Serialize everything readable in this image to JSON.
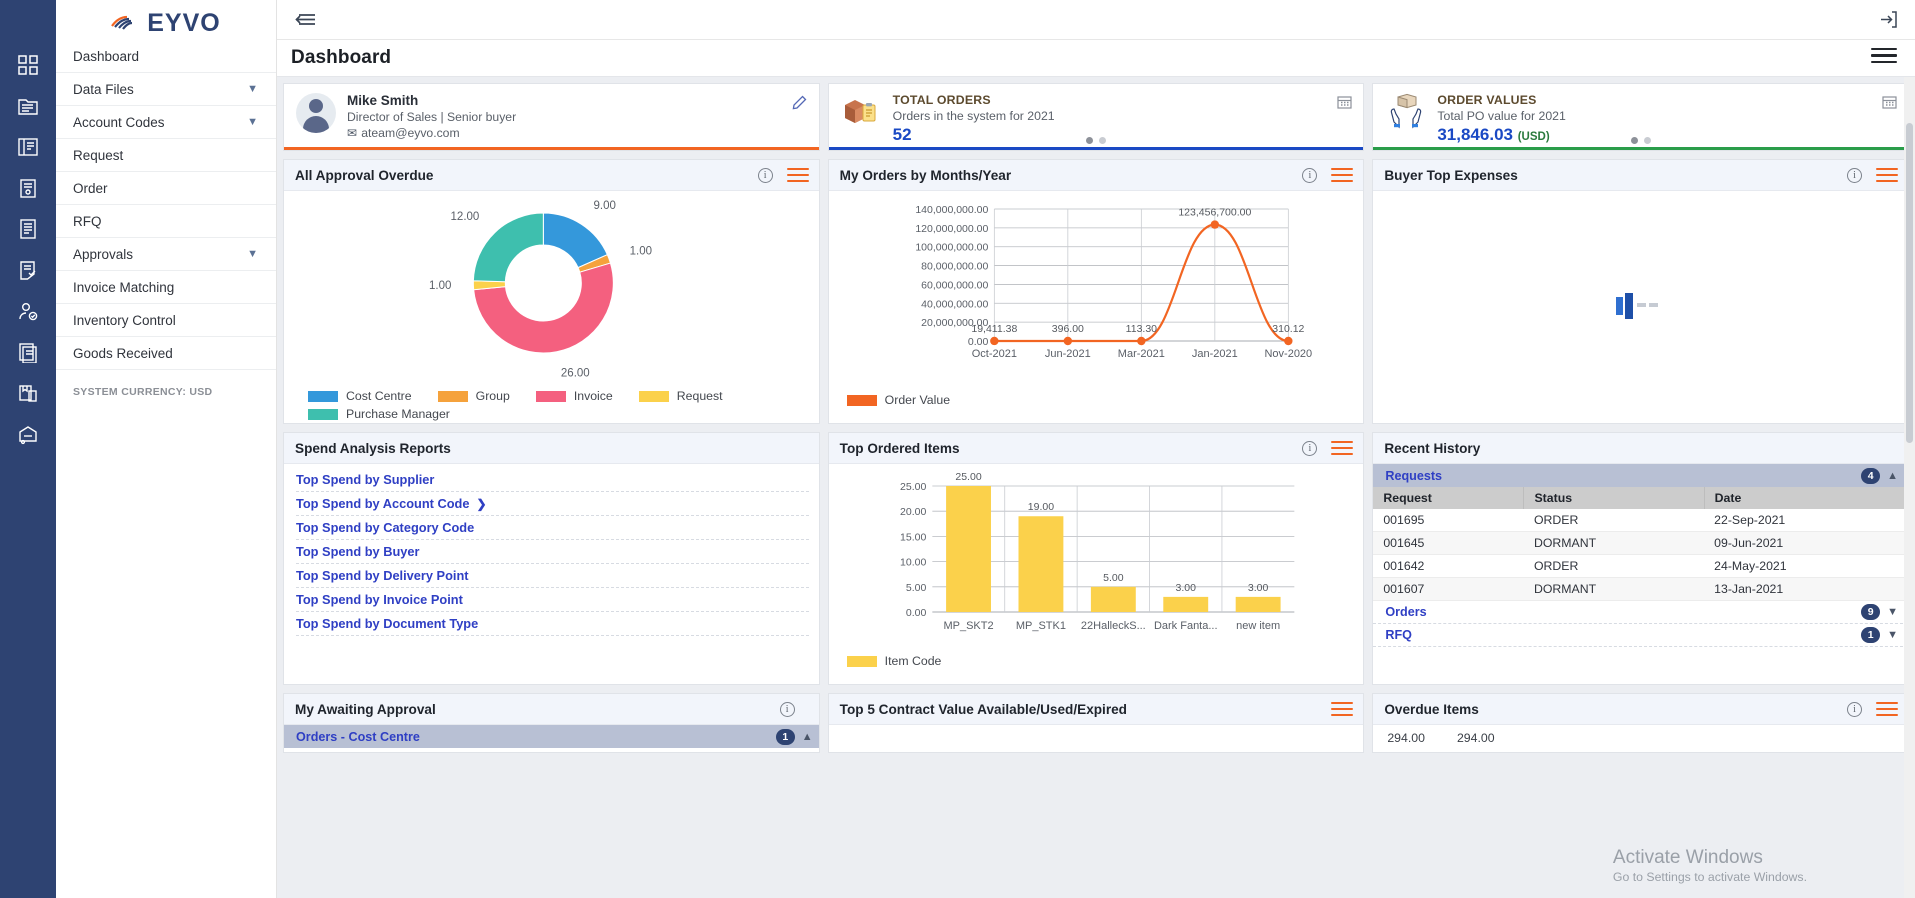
{
  "brand": {
    "name": "EYVO"
  },
  "sidebar": {
    "items": [
      {
        "label": "Dashboard",
        "icon": "grid-icon",
        "expandable": false
      },
      {
        "label": "Data Files",
        "icon": "folder-icon",
        "expandable": true
      },
      {
        "label": "Account Codes",
        "icon": "ledger-icon",
        "expandable": true
      },
      {
        "label": "Request",
        "icon": "request-icon",
        "expandable": false
      },
      {
        "label": "Order",
        "icon": "order-icon",
        "expandable": false
      },
      {
        "label": "RFQ",
        "icon": "rfq-icon",
        "expandable": false
      },
      {
        "label": "Approvals",
        "icon": "approval-user-icon",
        "expandable": true
      },
      {
        "label": "Invoice Matching",
        "icon": "invoice-icon",
        "expandable": false
      },
      {
        "label": "Inventory Control",
        "icon": "inventory-icon",
        "expandable": false
      },
      {
        "label": "Goods Received",
        "icon": "goods-icon",
        "expandable": false
      }
    ],
    "footer": "SYSTEM CURRENCY: USD"
  },
  "header": {
    "title": "Dashboard"
  },
  "profile": {
    "name": "Mike Smith",
    "role": "Director of Sales | Senior buyer",
    "email": "ateam@eyvo.com",
    "accent": "#f26522"
  },
  "total_orders": {
    "title": "TOTAL ORDERS",
    "subtitle": "Orders in the system for 2021",
    "value": "52",
    "accent": "#1a49c4"
  },
  "order_values": {
    "title": "ORDER VALUES",
    "subtitle": "Total PO value for 2021",
    "value": "31,846.03",
    "currency": "(USD)",
    "accent": "#2a9d4a"
  },
  "widgets": {
    "approval_overdue": {
      "title": "All Approval Overdue"
    },
    "orders_by_month": {
      "title": "My Orders by Months/Year"
    },
    "buyer_top_expenses": {
      "title": "Buyer Top Expenses"
    },
    "spend_analysis": {
      "title": "Spend Analysis Reports"
    },
    "top_ordered_items": {
      "title": "Top Ordered Items"
    },
    "recent_history": {
      "title": "Recent History"
    },
    "my_awaiting_approval": {
      "title": "My Awaiting Approval"
    },
    "top5_contract": {
      "title": "Top 5 Contract Value Available/Used/Expired"
    },
    "overdue_items": {
      "title": "Overdue Items"
    }
  },
  "spend_reports": [
    {
      "label": "Top Spend by Supplier",
      "arrow": false
    },
    {
      "label": "Top Spend by Account Code",
      "arrow": true
    },
    {
      "label": "Top Spend by Category Code",
      "arrow": false
    },
    {
      "label": "Top Spend by Buyer",
      "arrow": false
    },
    {
      "label": "Top Spend by Delivery Point",
      "arrow": false
    },
    {
      "label": "Top Spend by Invoice Point",
      "arrow": false
    },
    {
      "label": "Top Spend by Document Type",
      "arrow": false
    }
  ],
  "recent_history": {
    "groups": [
      {
        "label": "Requests",
        "count": "4",
        "caret": "up",
        "active": true
      },
      {
        "label": "Orders",
        "count": "9",
        "caret": "down",
        "active": false
      },
      {
        "label": "RFQ",
        "count": "1",
        "caret": "down",
        "active": false
      }
    ],
    "columns": [
      "Request",
      "Status",
      "Date"
    ],
    "rows": [
      [
        "001695",
        "ORDER",
        "22-Sep-2021"
      ],
      [
        "001645",
        "DORMANT",
        "09-Jun-2021"
      ],
      [
        "001642",
        "ORDER",
        "24-May-2021"
      ],
      [
        "001607",
        "DORMANT",
        "13-Jan-2021"
      ]
    ]
  },
  "awaiting_approval": {
    "rows": [
      {
        "label": "Orders - Cost Centre",
        "count": "1",
        "caret": "up"
      }
    ]
  },
  "overdue_items": {
    "values": [
      "294.00",
      "294.00"
    ]
  },
  "watermark": {
    "line1": "Activate Windows",
    "line2": "Go to Settings to activate Windows."
  },
  "chart_data": [
    {
      "id": "approval-overdue-donut",
      "type": "pie",
      "title": "All Approval Overdue",
      "categories": [
        "Cost Centre",
        "Group",
        "Invoice",
        "Request",
        "Purchase Manager"
      ],
      "values": [
        9.0,
        1.0,
        26.0,
        1.0,
        12.0
      ],
      "labels": [
        "9.00",
        "1.00",
        "26.00",
        "1.00",
        "12.00"
      ],
      "colors": [
        "#3498db",
        "#f5a23c",
        "#f4607f",
        "#f9d košt"
      ],
      "palette": [
        "#3498db",
        "#f5a23c",
        "#f4607f",
        "#fbd14b",
        "#3ebfae"
      ],
      "legend_position": "bottom",
      "donut": true
    },
    {
      "id": "orders-by-month-line",
      "type": "line",
      "title": "My Orders by Months/Year",
      "x": [
        "Oct-2021",
        "Jun-2021",
        "Mar-2021",
        "Jan-2021",
        "Nov-2020"
      ],
      "series": [
        {
          "name": "Order Value",
          "values": [
            19411.38,
            396.0,
            113.3,
            123456700.0,
            310.12
          ],
          "color": "#f26522"
        }
      ],
      "point_labels": [
        "19,411.38",
        "396.00",
        "113.30",
        "123,456,700.00",
        "310.12"
      ],
      "ylim": [
        0,
        140000000
      ],
      "ytick_labels": [
        "0.00",
        "20,000,000.00",
        "40,000,000.00",
        "60,000,000.00",
        "80,000,000.00",
        "100,000,000.00",
        "120,000,000.00",
        "140,000,000.00"
      ],
      "xlabel": "",
      "ylabel": "",
      "grid": true,
      "legend": [
        "Order Value"
      ],
      "legend_position": "bottom"
    },
    {
      "id": "top-ordered-items-bar",
      "type": "bar",
      "title": "Top Ordered Items",
      "categories": [
        "MP_SKT2",
        "MP_STK1",
        "22HalleckS...",
        "Dark Fanta...",
        "new item"
      ],
      "values": [
        25.0,
        19.0,
        5.0,
        3.0,
        3.0
      ],
      "bar_labels": [
        "25.00",
        "19.00",
        "5.00",
        "3.00",
        "3.00"
      ],
      "ylim": [
        0,
        25
      ],
      "ytick_labels": [
        "0.00",
        "5.00",
        "10.00",
        "15.00",
        "20.00",
        "25.00"
      ],
      "color": "#fbd14b",
      "legend": [
        "Item Code"
      ],
      "legend_position": "bottom",
      "grid": true
    }
  ]
}
